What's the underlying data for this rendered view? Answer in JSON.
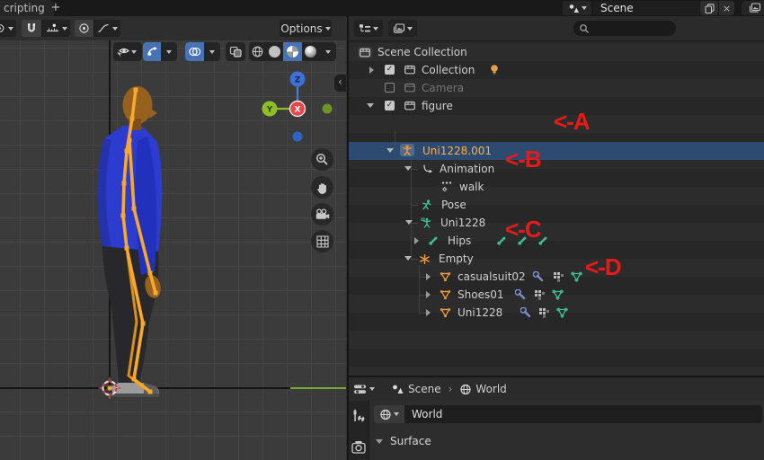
{
  "topbar": {
    "workspace_tab": "cripting",
    "scene_name": "Scene"
  },
  "viewport_toolbar": {
    "options_label": "Options"
  },
  "viewport": {
    "gizmo": {
      "z": "Z",
      "y": "Y",
      "x": "X"
    }
  },
  "outliner": {
    "search_value": "",
    "rows": [
      {
        "label": "Scene Collection"
      },
      {
        "label": "Collection"
      },
      {
        "label": "Camera"
      },
      {
        "label": "figure"
      },
      {
        "label": "Uni1228.001"
      },
      {
        "label": "Animation"
      },
      {
        "label": "walk"
      },
      {
        "label": "Pose"
      },
      {
        "label": "Uni1228"
      },
      {
        "label": "Hips"
      },
      {
        "label": "Empty"
      },
      {
        "label": "casualsuit02"
      },
      {
        "label": "Shoes01"
      },
      {
        "label": "Uni1228"
      }
    ]
  },
  "properties": {
    "breadcrumb_scene": "Scene",
    "breadcrumb_world": "World",
    "world_name": "World",
    "surface_panel_label": "Surface"
  },
  "annotations": {
    "a": "<-A",
    "b": "<-B",
    "c": "<-C",
    "d": "<-D"
  },
  "icons": {
    "check": "✓",
    "close": "×",
    "plus": "+",
    "breadcrumb_separator": "›",
    "collapse_left": "‹"
  },
  "colors": {
    "annotation_red": "#e81a17",
    "selection_blue": "#2d4a71",
    "selected_text_orange": "#ffaf45",
    "accent_blue": "#4772b3",
    "icon_orange": "#e9973c",
    "icon_teal": "#3ebc8f",
    "wrench_blue": "#7b90cf",
    "axis_x_red": "#e5484d",
    "axis_y_green": "#8fbf26",
    "axis_z_blue": "#3f6fd8",
    "ground_line_green": "#74a833",
    "shirt_blue": "#2b3cce",
    "armature_orange": "#f7a82d"
  }
}
